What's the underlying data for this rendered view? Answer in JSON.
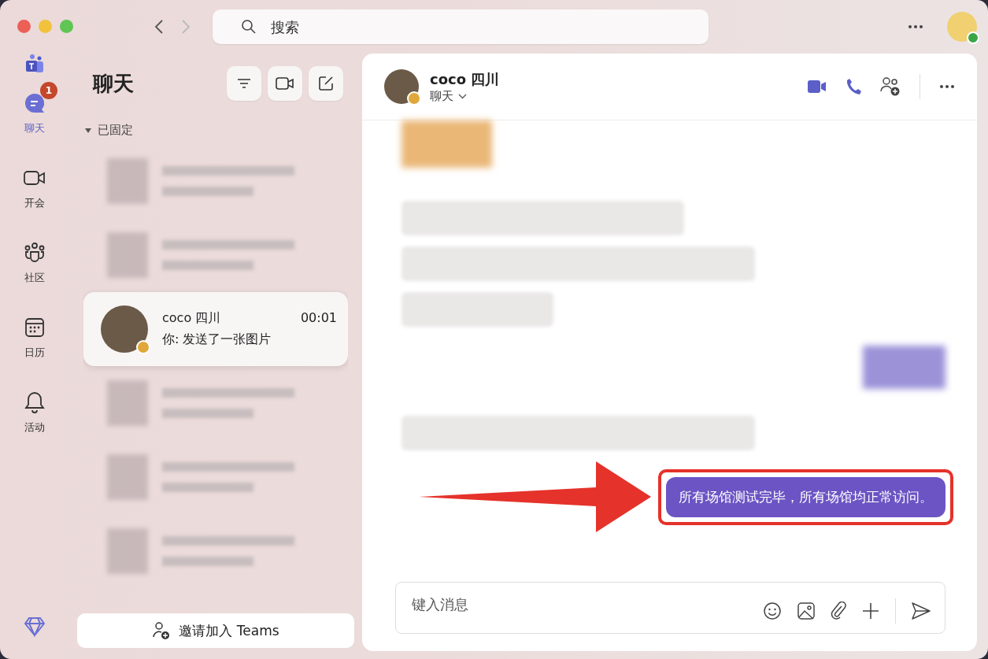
{
  "search": {
    "placeholder": "搜索"
  },
  "rail": [
    {
      "kind": "chat",
      "label": "聊天",
      "selected": true,
      "badge": "1"
    },
    {
      "kind": "meet",
      "label": "开会",
      "selected": false
    },
    {
      "kind": "community",
      "label": "社区",
      "selected": false
    },
    {
      "kind": "calendar",
      "label": "日历",
      "selected": false
    },
    {
      "kind": "activity",
      "label": "活动",
      "selected": false
    }
  ],
  "chat_list": {
    "title": "聊天",
    "section": "已固定",
    "items": [
      {
        "kind": "blurred",
        "selected": false
      },
      {
        "kind": "blurred",
        "selected": false
      },
      {
        "kind": "contact",
        "selected": true,
        "name": "coco 四川",
        "time": "00:01",
        "preview": "你: 发送了一张图片"
      },
      {
        "kind": "blurred",
        "selected": false
      },
      {
        "kind": "blurred",
        "selected": false
      },
      {
        "kind": "blurred",
        "selected": false
      }
    ]
  },
  "invite_button": "邀请加入 Teams",
  "conversation": {
    "name": "coco 四川",
    "subtitle": "聊天",
    "messages": [
      {
        "kind": "blurred_image",
        "outgoing": false
      },
      {
        "kind": "blurred",
        "outgoing": false
      },
      {
        "kind": "blurred",
        "outgoing": false
      },
      {
        "kind": "blurred",
        "outgoing": false
      },
      {
        "kind": "blurred_image",
        "outgoing": true
      },
      {
        "kind": "blurred",
        "outgoing": false
      },
      {
        "kind": "text",
        "outgoing": true,
        "highlighted": true,
        "text": "所有场馆测试完毕，所有场馆均正常访问。"
      }
    ]
  },
  "composer": {
    "placeholder": "键入消息"
  }
}
